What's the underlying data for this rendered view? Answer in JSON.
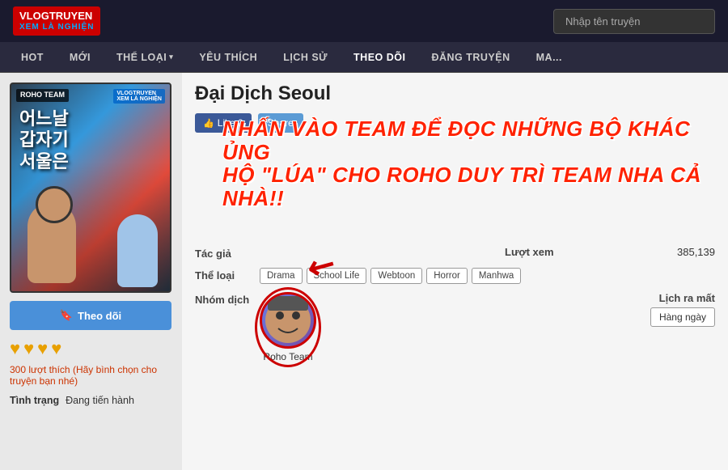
{
  "header": {
    "logo_line1": "VLOGTRUYEN",
    "logo_line2": "XEM LÀ NGHIỆN",
    "search_placeholder": "Nhập tên truyện",
    "theo_doi_label": "THEO DÕI"
  },
  "nav": {
    "items": [
      {
        "label": "HOT"
      },
      {
        "label": "MỚI"
      },
      {
        "label": "THỂ LOẠI",
        "has_arrow": true
      },
      {
        "label": "YÊU THÍCH"
      },
      {
        "label": "LỊCH SỬ"
      },
      {
        "label": "THEO DÕI"
      },
      {
        "label": "ĐĂNG TRUYỆN"
      },
      {
        "label": "MA..."
      }
    ]
  },
  "manga": {
    "title": "Đại Dịch Seoul",
    "cover_title_kr_line1": "어느날",
    "cover_title_kr_line2": "갑자기",
    "cover_title_kr_line3": "서울은",
    "cover_roho": "ROHO\nTEAM",
    "like_label": "Like 0",
    "share_label": "Share",
    "overlay_line1": "NHẤN VÀO TEAM ĐỂ ĐỌC NHỮNG BỘ KHÁC ỦNG",
    "overlay_line2": "HỘ \"LÚA\" CHO ROHO DUY TRÌ TEAM NHA CẢ NHÀ!!",
    "info": {
      "tac_gia_label": "Tác giả",
      "tac_gia_value": "",
      "luot_xem_label": "Lượt xem",
      "luot_xem_value": "385,139",
      "the_loai_label": "Thể loại",
      "nhom_dich_label": "Nhóm dịch",
      "lich_ra_mat_label": "Lịch ra mất",
      "lich_ra_mat_value": "Hàng ngày"
    },
    "genres": [
      "Drama",
      "School Life",
      "Webtoon",
      "Horror",
      "Manhwa"
    ],
    "translator": {
      "name": "Roho Team"
    },
    "follow_btn": "Theo dõi",
    "likes_count": "300 lượt thích",
    "likes_vote": "(Hãy bình chọn cho truyện bạn nhé)",
    "tinh_trang_label": "Tình trạng",
    "tinh_trang_value": "Đang tiến hành"
  }
}
